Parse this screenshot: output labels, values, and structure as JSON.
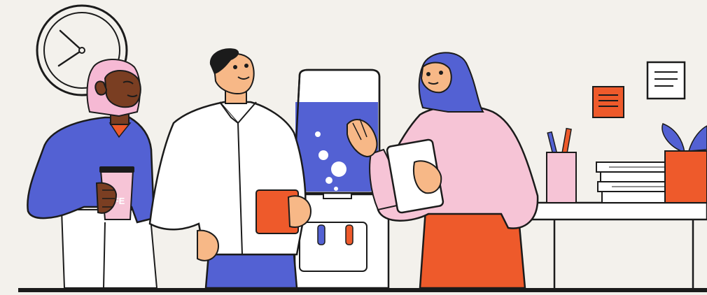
{
  "scene": {
    "cup_text": "FE"
  },
  "colors": {
    "background": "#f3f1ec",
    "outline": "#1b1b1b",
    "blue": "#5361d3",
    "pink": "#f6c4d6",
    "orange": "#ee5a2b",
    "white": "#ffffff",
    "skin_dark": "#7a3e22",
    "skin_light": "#f7b887",
    "hair_pink": "#f6b9d4"
  },
  "icons": [
    "wall-clock",
    "memo-note",
    "wall-poster",
    "water-cooler",
    "pencil-cup",
    "paper-stack",
    "potted-plant",
    "coffee-cup",
    "mug",
    "tablet"
  ]
}
